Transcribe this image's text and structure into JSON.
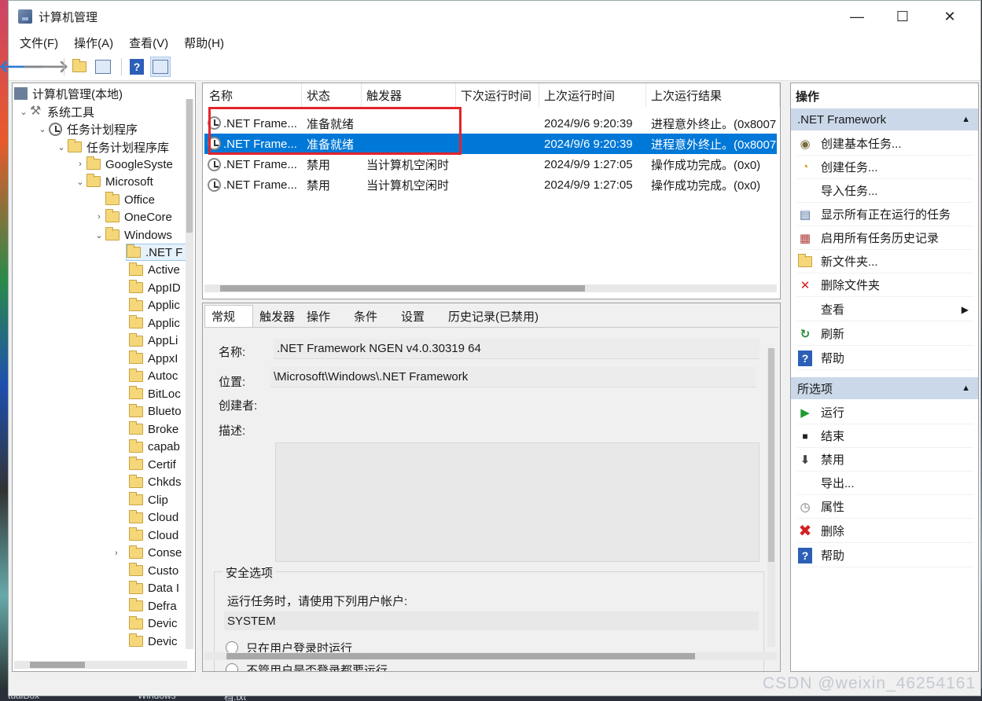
{
  "window": {
    "title": "计算机管理",
    "minimize": "—",
    "maximize": "☐",
    "close": "✕"
  },
  "menu": [
    "文件(F)",
    "操作(A)",
    "查看(V)",
    "帮助(H)"
  ],
  "tree": {
    "root": "计算机管理(本地)",
    "system_tools": "系统工具",
    "task_scheduler": "任务计划程序",
    "library": "任务计划程序库",
    "google": "GoogleSyste",
    "microsoft": "Microsoft",
    "office": "Office",
    "onecore": "OneCore",
    "windows": "Windows",
    "children": [
      ".NET F",
      "Active",
      "AppID",
      "Applic",
      "Applic",
      "AppLi",
      "AppxI",
      "Autoc",
      "BitLoc",
      "Blueto",
      "Broke",
      "capab",
      "Certif",
      "Chkds",
      "Clip",
      "Cloud",
      "Cloud",
      "Conse",
      "Custo",
      "Data I",
      "Defra",
      "Devic",
      "Devic"
    ]
  },
  "tasklist": {
    "columns": [
      "名称",
      "状态",
      "触发器",
      "下次运行时间",
      "上次运行时间",
      "上次运行结果"
    ],
    "rows": [
      {
        "name": ".NET Frame...",
        "status": "准备就绪",
        "trigger": "",
        "next": "",
        "last": "2024/9/6 9:20:39",
        "result": "进程意外终止。(0x8007"
      },
      {
        "name": ".NET Frame...",
        "status": "准备就绪",
        "trigger": "",
        "next": "",
        "last": "2024/9/6 9:20:39",
        "result": "进程意外终止。(0x8007"
      },
      {
        "name": ".NET Frame...",
        "status": "禁用",
        "trigger": "当计算机空闲时",
        "next": "",
        "last": "2024/9/9 1:27:05",
        "result": "操作成功完成。(0x0)"
      },
      {
        "name": ".NET Frame...",
        "status": "禁用",
        "trigger": "当计算机空闲时",
        "next": "",
        "last": "2024/9/9 1:27:05",
        "result": "操作成功完成。(0x0)"
      }
    ]
  },
  "detail": {
    "tabs": [
      "常规",
      "触发器",
      "操作",
      "条件",
      "设置",
      "历史记录(已禁用)"
    ],
    "name_label": "名称:",
    "name_value": ".NET Framework NGEN v4.0.30319 64",
    "location_label": "位置:",
    "location_value": "\\Microsoft\\Windows\\.NET Framework",
    "author_label": "创建者:",
    "desc_label": "描述:",
    "security_label": "安全选项",
    "run_as_label": "运行任务时，请使用下列用户帐户:",
    "run_as_value": "SYSTEM",
    "radio1": "只在用户登录时运行",
    "radio2": "不管用户是否登录都要运行"
  },
  "actions": {
    "header": "操作",
    "section1": ".NET Framework",
    "items1": [
      "创建基本任务...",
      "创建任务...",
      "导入任务...",
      "显示所有正在运行的任务",
      "启用所有任务历史记录",
      "新文件夹...",
      "删除文件夹",
      "查看",
      "刷新",
      "帮助"
    ],
    "section2": "所选项",
    "items2": [
      "运行",
      "结束",
      "禁用",
      "导出...",
      "属性",
      "删除",
      "帮助"
    ]
  },
  "taskbar_fragments": [
    "tualBox",
    "Windows",
    "档.txt"
  ],
  "watermark": "CSDN @weixin_46254161",
  "colors": {
    "selection": "#0078d7",
    "highlight_box": "#e3242b",
    "action_section": "#cad8ea"
  }
}
